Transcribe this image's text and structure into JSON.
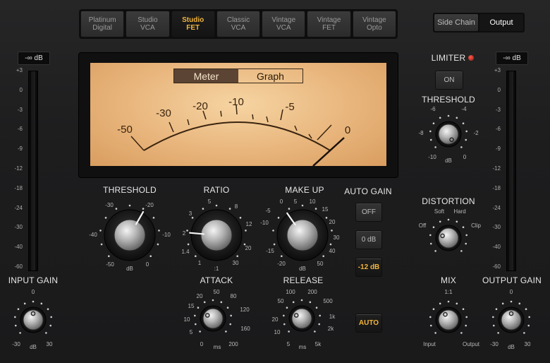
{
  "models": [
    {
      "label": "Platinum\nDigital",
      "active": false
    },
    {
      "label": "Studio\nVCA",
      "active": false
    },
    {
      "label": "Studio\nFET",
      "active": true
    },
    {
      "label": "Classic\nVCA",
      "active": false
    },
    {
      "label": "Vintage\nVCA",
      "active": false
    },
    {
      "label": "Vintage\nFET",
      "active": false
    },
    {
      "label": "Vintage\nOpto",
      "active": false
    }
  ],
  "view_tabs": {
    "side_chain": "Side Chain",
    "output": "Output"
  },
  "input_meter": {
    "readout": "-∞ dB",
    "scale": [
      "+3",
      "0",
      "-3",
      "-6",
      "-9",
      "-12",
      "-18",
      "-24",
      "-30",
      "-40",
      "-60"
    ]
  },
  "output_meter": {
    "readout": "-∞ dB",
    "scale": [
      "+3",
      "0",
      "-3",
      "-6",
      "-9",
      "-12",
      "-18",
      "-24",
      "-30",
      "-40",
      "-60"
    ]
  },
  "vu": {
    "toggle": {
      "meter": "Meter",
      "graph": "Graph"
    },
    "scale": [
      "-50",
      "-30",
      "-20",
      "-10",
      "-5",
      "0"
    ]
  },
  "threshold": {
    "label": "THRESHOLD",
    "ticks": [
      "-30",
      "-20",
      "-40",
      "-10",
      "-50",
      "dB",
      "0"
    ]
  },
  "ratio": {
    "label": "RATIO",
    "ticks": [
      "5",
      "8",
      "3",
      "12",
      "2",
      "20",
      "1.4",
      "30",
      "1",
      ":1"
    ]
  },
  "makeup": {
    "label": "MAKE UP",
    "ticks": [
      "0",
      "5",
      "10",
      "-5",
      "15",
      "-10",
      "20",
      "-15",
      "30",
      "-20",
      "40",
      "dB",
      "50"
    ]
  },
  "auto_gain": {
    "label": "AUTO GAIN",
    "options": [
      "OFF",
      "0 dB",
      "-12 dB"
    ],
    "selected": "-12 dB"
  },
  "attack": {
    "label": "ATTACK",
    "ticks": [
      "20",
      "50",
      "80",
      "15",
      "120",
      "10",
      "160",
      "5",
      "200",
      "0",
      "ms"
    ]
  },
  "release": {
    "label": "RELEASE",
    "ticks": [
      "100",
      "200",
      "50",
      "500",
      "20",
      "1k",
      "10",
      "2k",
      "5",
      "ms",
      "5k"
    ]
  },
  "auto_button": "AUTO",
  "input_gain": {
    "label": "INPUT GAIN",
    "ticks": [
      "0",
      "-30",
      "dB",
      "30"
    ]
  },
  "limiter": {
    "label": "LIMITER",
    "button": "ON"
  },
  "limiter_threshold": {
    "label": "THRESHOLD",
    "ticks": [
      "-6",
      "-4",
      "-8",
      "-2",
      "-10",
      "dB",
      "0"
    ]
  },
  "distortion": {
    "label": "DISTORTION",
    "ticks": [
      "Soft",
      "Hard",
      "Off",
      "Clip"
    ]
  },
  "mix": {
    "label": "MIX",
    "ticks": [
      "1:1",
      "Input",
      "Output"
    ]
  },
  "output_gain": {
    "label": "OUTPUT GAIN",
    "ticks": [
      "0",
      "-30",
      "dB",
      "30"
    ]
  },
  "colors": {
    "accent": "#f2b53b",
    "vu_face": "#e8b57c",
    "led": "#e03a2a"
  }
}
